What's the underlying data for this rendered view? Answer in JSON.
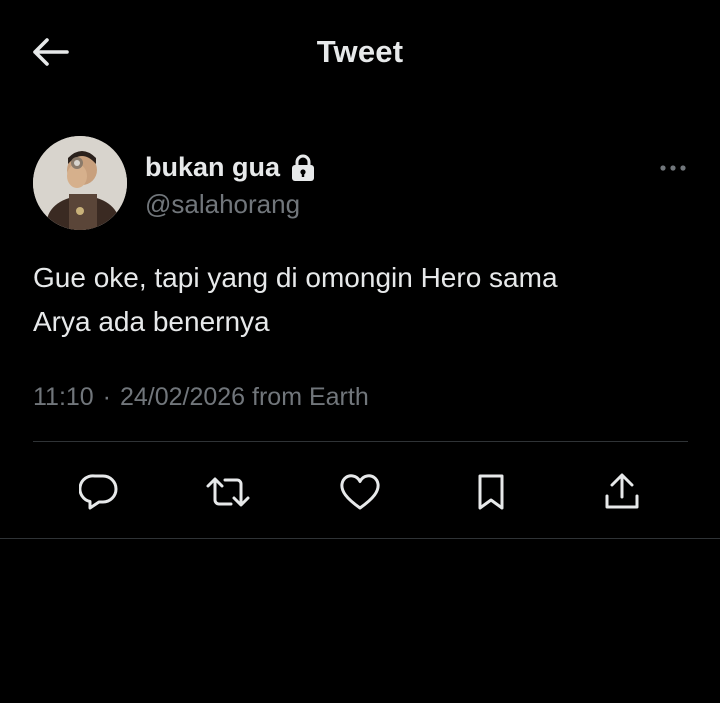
{
  "header": {
    "title": "Tweet",
    "back_icon": "arrow-left-icon"
  },
  "author": {
    "display_name": "bukan gua",
    "handle": "@salahorang",
    "protected_icon": "lock-icon"
  },
  "tweet": {
    "text": "Gue oke, tapi yang di omongin Hero sama\nArya ada benernya",
    "time": "11:10",
    "separator": "·",
    "date": "24/02/2026",
    "source": "from Earth"
  },
  "actions": [
    {
      "name": "reply",
      "icon": "reply-icon"
    },
    {
      "name": "retweet",
      "icon": "retweet-icon"
    },
    {
      "name": "like",
      "icon": "heart-icon"
    },
    {
      "name": "bookmark",
      "icon": "bookmark-icon"
    },
    {
      "name": "share",
      "icon": "share-icon"
    }
  ],
  "colors": {
    "background": "#000000",
    "text_primary": "#e7e9ea",
    "text_secondary": "#71767b",
    "divider": "#2f3336"
  }
}
